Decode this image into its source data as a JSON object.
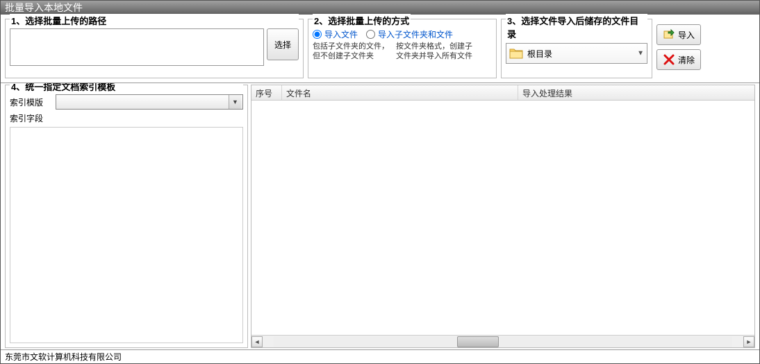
{
  "window": {
    "title": "批量导入本地文件"
  },
  "section1": {
    "title": "1、选择批量上传的路径",
    "path_value": "",
    "select_btn": "选择"
  },
  "section2": {
    "title": "2、选择批量上传的方式",
    "radio1": "导入文件",
    "radio2": "导入子文件夹和文件",
    "desc1": "包括子文件夹的文件，但不创建子文件夹",
    "desc2": "按文件夹格式，创建子文件夹并导入所有文件"
  },
  "section3": {
    "title": "3、选择文件导入后储存的文件目录",
    "root_dir": "根目录"
  },
  "actions": {
    "import": "导入",
    "clear": "清除"
  },
  "section4": {
    "title": "4、统一指定文档索引模板",
    "template_label": "索引模版",
    "template_value": "",
    "fields_label": "索引字段"
  },
  "table": {
    "col_seq": "序号",
    "col_filename": "文件名",
    "col_result": "导入处理结果"
  },
  "statusbar": {
    "company": "东莞市文软计算机科技有限公司"
  },
  "icons": {
    "folder": "folder-icon",
    "import": "import-icon",
    "clear": "clear-icon",
    "dropdown": "chevron-down-icon"
  }
}
